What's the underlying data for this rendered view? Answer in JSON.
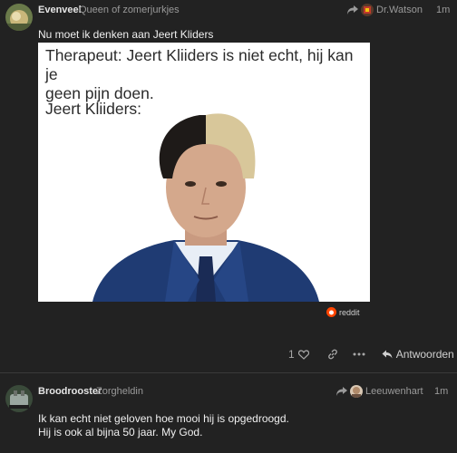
{
  "post1": {
    "username": "Evenveel",
    "user_title": "Queen of zomerjurkjes",
    "reply_to": "Dr.Watson",
    "time": "1m",
    "text": "Nu moet ik denken aan Jeert Kliders",
    "image": {
      "caption_line1": "Therapeut: Jeert Kliiders is niet echt, hij kan je",
      "caption_line2": "geen pijn doen.",
      "caption_line3": "Jeert Kliiders:"
    },
    "source_badge": "reddit",
    "like_count": "1",
    "reply_label": "Antwoorden"
  },
  "post2": {
    "username": "Broodrooster",
    "user_title": "Zorgheldin",
    "reply_to": "Leeuwenhart",
    "time": "1m",
    "text_line1": "Ik kan echt niet geloven hoe mooi hij is opgedroogd.",
    "text_line2": "Hij is ook al bijna 50 jaar. My God."
  },
  "colors": {
    "background": "#222222",
    "reddit": "#ff4500",
    "suit": "#1f3b73"
  },
  "icons": [
    "reply-arrow-icon",
    "heart-icon",
    "link-icon",
    "more-icon",
    "reply-icon",
    "reddit-icon"
  ]
}
